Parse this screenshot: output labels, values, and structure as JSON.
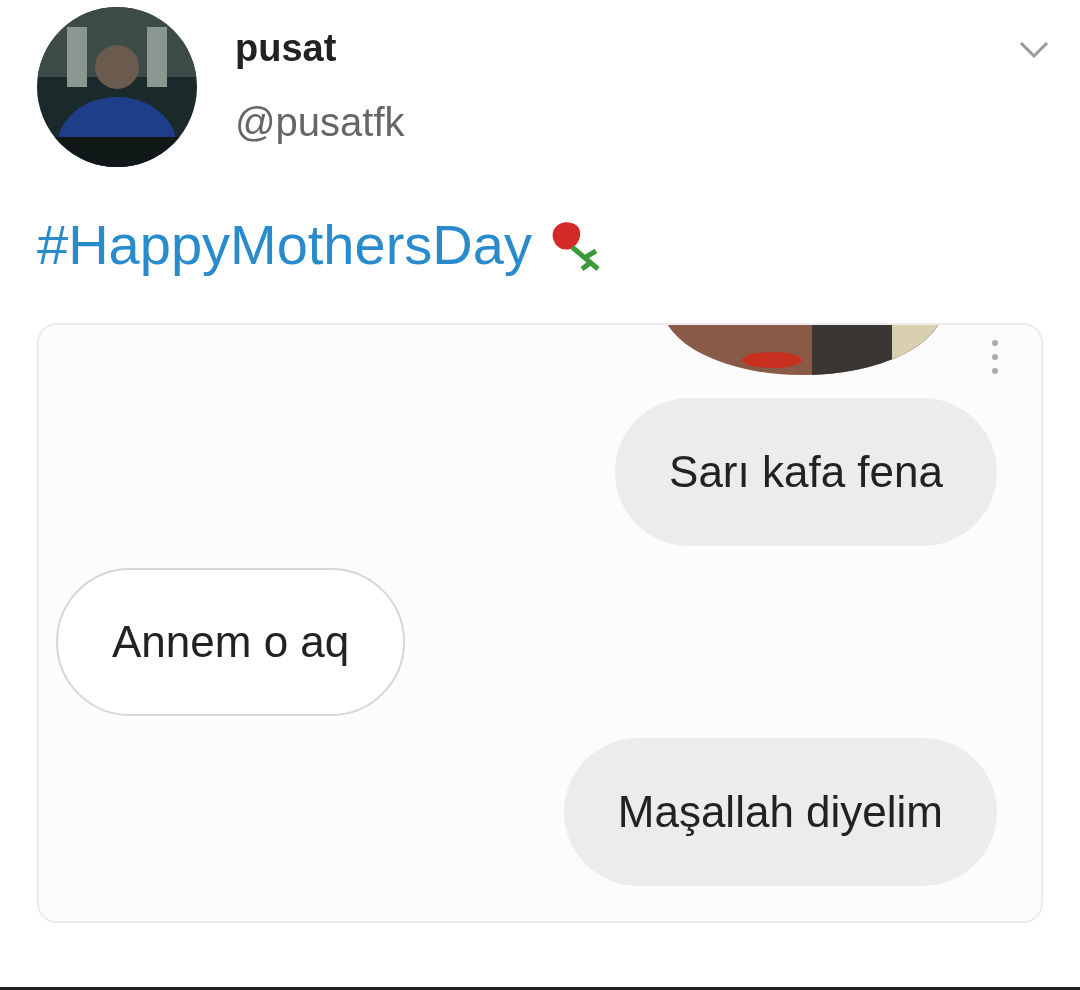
{
  "tweet": {
    "name": "pusat",
    "handle": "@pusatfk",
    "hashtag": "#HappyMothersDay"
  },
  "chat": {
    "messages": [
      {
        "text": "Sarı kafa fena",
        "kind": "sent"
      },
      {
        "text": "Annem o aq",
        "kind": "received"
      },
      {
        "text": "Maşallah diyelim",
        "kind": "sent"
      }
    ]
  }
}
